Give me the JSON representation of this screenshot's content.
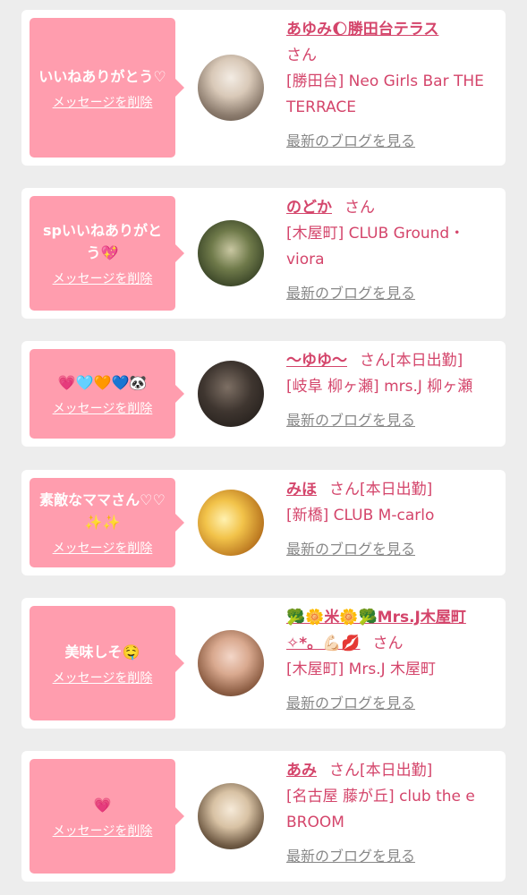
{
  "cards": [
    {
      "message": "いいねありがとう♡",
      "delete_label": "メッセージを削除",
      "name": "あゆみ🌔勝田台テラス",
      "honorific": "さん",
      "working_today": "",
      "shop": "[勝田台] Neo Girls Bar THE TERRACE",
      "blog_label": "最新のブログを見る"
    },
    {
      "message": "spいいねありがとう💖",
      "delete_label": "メッセージを削除",
      "name": "のどか",
      "honorific": "さん",
      "working_today": "",
      "shop": "[木屋町] CLUB Ground・viora",
      "blog_label": "最新のブログを見る"
    },
    {
      "message": "💗🩵🧡💙🐼",
      "delete_label": "メッセージを削除",
      "name": "〜ゆゆ〜",
      "honorific": "さん",
      "working_today": "[本日出勤]",
      "shop": "[岐阜 柳ヶ瀬] mrs.J 柳ヶ瀬",
      "blog_label": "最新のブログを見る"
    },
    {
      "message": "素敵なママさん♡♡✨✨",
      "delete_label": "メッセージを削除",
      "name": "みほ",
      "honorific": "さん",
      "working_today": "[本日出勤]",
      "shop": "[新橋] CLUB M-carlo",
      "blog_label": "最新のブログを見る"
    },
    {
      "message": "美味しそ🤤",
      "delete_label": "メッセージを削除",
      "name": "🥦🌼米🌼🥦Mrs.J木屋町✧*。💪🏻💋",
      "honorific": "さん",
      "working_today": "",
      "shop": "[木屋町] Mrs.J 木屋町",
      "blog_label": "最新のブログを見る"
    },
    {
      "message": "💗",
      "delete_label": "メッセージを削除",
      "name": "あみ",
      "honorific": "さん",
      "working_today": "[本日出勤]",
      "shop": "[名古屋 藤が丘] club the e BROOM",
      "blog_label": "最新のブログを見る"
    }
  ]
}
